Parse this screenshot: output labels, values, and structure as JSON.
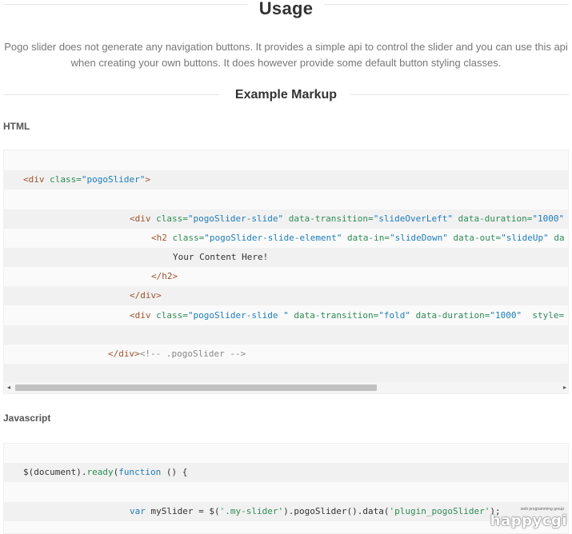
{
  "usage": {
    "title": "Usage",
    "intro_line1": "Pogo slider does not generate any navigation buttons. It provides a simple api to control the slider and you can use this api",
    "intro_line2": "when creating your own buttons. It does however provide some default button styling classes."
  },
  "example": {
    "title": "Example Markup"
  },
  "html_section": {
    "label": "HTML",
    "lines": [
      {
        "indent": "",
        "parts": []
      },
      {
        "indent": "l1",
        "parts": [
          {
            "cls": "tag",
            "t": "<div "
          },
          {
            "cls": "attr",
            "t": "class="
          },
          {
            "cls": "str",
            "t": "\"pogoSlider\""
          },
          {
            "cls": "tag",
            "t": ">"
          }
        ]
      },
      {
        "indent": "",
        "parts": []
      },
      {
        "indent": "l3",
        "parts": [
          {
            "cls": "tag",
            "t": "<div "
          },
          {
            "cls": "attr",
            "t": "class="
          },
          {
            "cls": "str",
            "t": "\"pogoSlider-slide\""
          },
          {
            "cls": "attr",
            "t": " data-transition="
          },
          {
            "cls": "str",
            "t": "\"slideOverLeft\""
          },
          {
            "cls": "attr",
            "t": " data-duration="
          },
          {
            "cls": "str",
            "t": "\"1000\""
          }
        ]
      },
      {
        "indent": "l4",
        "parts": [
          {
            "cls": "tag",
            "t": "<h2 "
          },
          {
            "cls": "attr",
            "t": "class="
          },
          {
            "cls": "str",
            "t": "\"pogoSlider-slide-element\""
          },
          {
            "cls": "attr",
            "t": " data-in="
          },
          {
            "cls": "str",
            "t": "\"slideDown\""
          },
          {
            "cls": "attr",
            "t": " data-out="
          },
          {
            "cls": "str",
            "t": "\"slideUp\""
          },
          {
            "cls": "attr",
            "t": " da"
          }
        ]
      },
      {
        "indent": "l5",
        "parts": [
          {
            "cls": "plain",
            "t": "Your Content Here!"
          }
        ]
      },
      {
        "indent": "l4",
        "parts": [
          {
            "cls": "tag",
            "t": "</h2>"
          }
        ]
      },
      {
        "indent": "l3",
        "parts": [
          {
            "cls": "tag",
            "t": "</div>"
          }
        ]
      },
      {
        "indent": "l3",
        "parts": [
          {
            "cls": "tag",
            "t": "<div "
          },
          {
            "cls": "attr",
            "t": "class="
          },
          {
            "cls": "str",
            "t": "\"pogoSlider-slide \""
          },
          {
            "cls": "attr",
            "t": " data-transition="
          },
          {
            "cls": "str",
            "t": "\"fold\""
          },
          {
            "cls": "attr",
            "t": " data-duration="
          },
          {
            "cls": "str",
            "t": "\"1000\""
          },
          {
            "cls": "attr",
            "t": "  style="
          }
        ]
      },
      {
        "indent": "",
        "parts": []
      },
      {
        "indent": "l2",
        "parts": [
          {
            "cls": "tag",
            "t": "</div>"
          },
          {
            "cls": "comment",
            "t": "<!-- .pogoSlider -->"
          }
        ]
      },
      {
        "indent": "",
        "parts": []
      }
    ],
    "scroll_left_arrow": "◂",
    "scroll_right_arrow": "▸"
  },
  "js_section": {
    "label": "Javascript",
    "lines": [
      {
        "indent": "",
        "parts": []
      },
      {
        "indent": "l1",
        "parts": [
          {
            "cls": "plain",
            "t": "$(document)."
          },
          {
            "cls": "fn",
            "t": "ready"
          },
          {
            "cls": "plain",
            "t": "("
          },
          {
            "cls": "kw",
            "t": "function"
          },
          {
            "cls": "plain",
            "t": " () {"
          }
        ]
      },
      {
        "indent": "",
        "parts": []
      },
      {
        "indent": "l3",
        "parts": [
          {
            "cls": "kw",
            "t": "var"
          },
          {
            "cls": "plain",
            "t": " mySlider = $("
          },
          {
            "cls": "fn",
            "t": "'.my-slider'"
          },
          {
            "cls": "plain",
            "t": ").pogoSlider().data("
          },
          {
            "cls": "fn",
            "t": "'plugin_pogoSlider'"
          },
          {
            "cls": "plain",
            "t": ");"
          }
        ]
      }
    ]
  },
  "watermark": {
    "brand": "happycgi",
    "tagline": "web programming group"
  }
}
